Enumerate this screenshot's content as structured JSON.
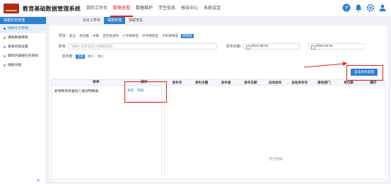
{
  "app": {
    "title": "教育基础数据管理系统"
  },
  "nav": [
    "我的工作台",
    "数据查看",
    "数据维护",
    "学生信息",
    "报告中心",
    "系统设定"
  ],
  "subnav": [
    "自定义表单",
    "填报管理",
    "填报查看"
  ],
  "sidebar": {
    "header": "填报任务管理",
    "items": [
      "填报任务管理",
      "填报数据审核",
      "表单权限设置",
      "期间内填报任务目标",
      "填报归档"
    ]
  },
  "filters": {
    "category_label": "项目:",
    "categories": [
      "全部",
      "安全",
      "新冠数",
      "中数",
      "自然资源的",
      "小学教研室",
      "中学教研室",
      "学前教研室",
      "研修处"
    ],
    "selected_category": "研修处",
    "form_label": "表单:",
    "form_placeholder": "请输入表单名称(可模糊查询)",
    "date_label": "发布日期:",
    "date_from": "2021-09-01",
    "date_sep": "-",
    "date_to": "2022-03-31",
    "publisher_label": "发布者:",
    "publishers": [
      "全部",
      "本人",
      "他人"
    ],
    "selected_publisher": "全部"
  },
  "create_button": "自动发布管理",
  "left_table": {
    "headers": [
      "表单",
      "操作"
    ],
    "rows": [
      {
        "name": "新增教育装备投入情况明细表",
        "actions": [
          "发布",
          "预览"
        ]
      }
    ]
  },
  "right_table": {
    "headers": [
      "发布号",
      "发布主题",
      "发布者",
      "发布日期",
      "自动发布",
      "自动发布号",
      "接收部门",
      "单位数",
      "操作"
    ],
    "empty": "暂无数据"
  },
  "colors": {
    "accent": "#2f80d1",
    "nav_active": "#e02020",
    "highlight_box": "#e02020"
  }
}
